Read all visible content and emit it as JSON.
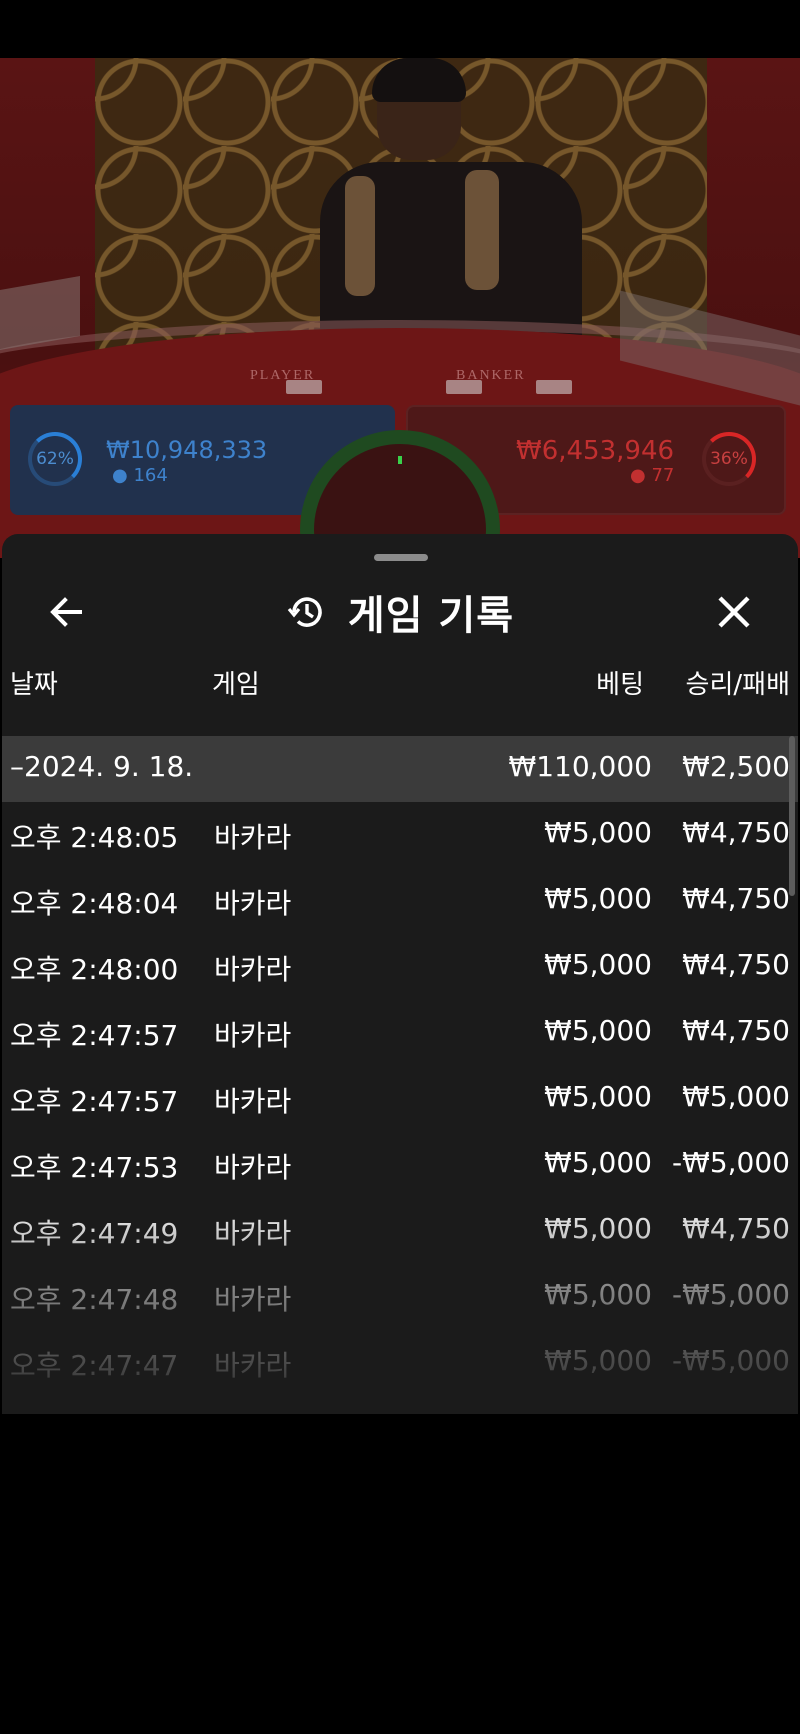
{
  "video": {
    "table_labels": {
      "player": "PLAYER",
      "banker": "BANKER"
    },
    "player": {
      "percent": "62%",
      "amount": "₩10,948,333",
      "count": "164"
    },
    "banker": {
      "percent": "36%",
      "amount": "₩6,453,946",
      "count": "77"
    }
  },
  "panel": {
    "title": "게임 기록",
    "icons": {
      "back": "arrow-left-icon",
      "history": "history-clock-icon",
      "close": "close-x-icon"
    },
    "columns": {
      "date": "날짜",
      "game": "게임",
      "bet": "베팅",
      "result": "승리/패배"
    },
    "summary": {
      "date": "–2024. 9. 18.",
      "bet": "₩110,000",
      "result": "₩2,500"
    },
    "rows": [
      {
        "time": "오후 2:48:05",
        "game": "바카라",
        "bet": "₩5,000",
        "result": "₩4,750"
      },
      {
        "time": "오후 2:48:04",
        "game": "바카라",
        "bet": "₩5,000",
        "result": "₩4,750"
      },
      {
        "time": "오후 2:48:00",
        "game": "바카라",
        "bet": "₩5,000",
        "result": "₩4,750"
      },
      {
        "time": "오후 2:47:57",
        "game": "바카라",
        "bet": "₩5,000",
        "result": "₩4,750"
      },
      {
        "time": "오후 2:47:57",
        "game": "바카라",
        "bet": "₩5,000",
        "result": "₩5,000"
      },
      {
        "time": "오후 2:47:53",
        "game": "바카라",
        "bet": "₩5,000",
        "result": "-₩5,000"
      },
      {
        "time": "오후 2:47:49",
        "game": "바카라",
        "bet": "₩5,000",
        "result": "₩4,750"
      },
      {
        "time": "오후 2:47:48",
        "game": "바카라",
        "bet": "₩5,000",
        "result": "-₩5,000"
      },
      {
        "time": "오후 2:47:47",
        "game": "바카라",
        "bet": "₩5,000",
        "result": "-₩5,000"
      }
    ]
  }
}
